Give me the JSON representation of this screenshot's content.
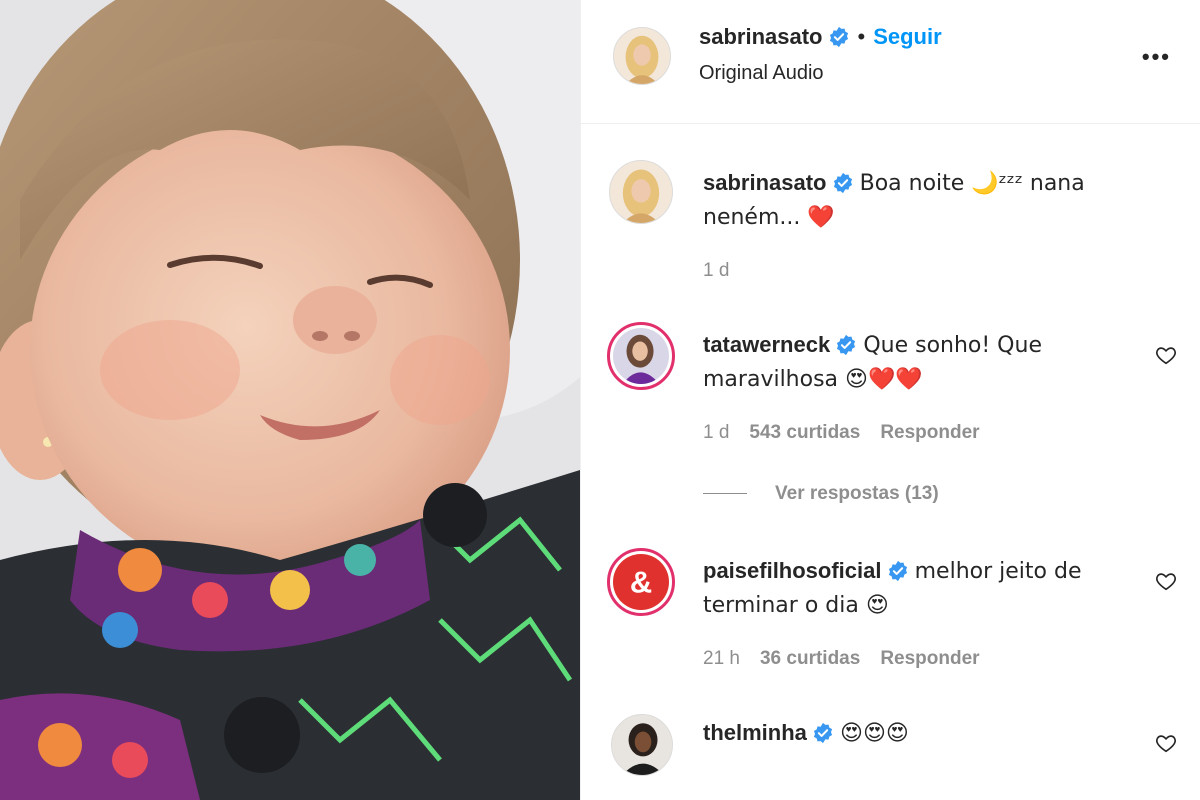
{
  "post": {
    "image_alt_subject": "toddler-photo"
  },
  "header": {
    "username": "sabrinasato",
    "follow_label": "Seguir",
    "separator": "•",
    "audio": "Original Audio",
    "more": "•••"
  },
  "caption": {
    "username": "sabrinasato",
    "text": "Boa noite 🌙ᶻᶻᶻ nana neném... ❤️",
    "time": "1 d"
  },
  "comments": [
    {
      "username": "tatawerneck",
      "text": "Que sonho! Que maravilhosa 😍❤️❤️",
      "time": "1 d",
      "likes": "543 curtidas",
      "reply": "Responder"
    },
    {
      "username": "paisefilhosoficial",
      "text": "melhor jeito de terminar o dia 😍",
      "time": "21 h",
      "likes": "36 curtidas",
      "reply": "Responder"
    },
    {
      "username": "thelminha",
      "text": "😍😍😍"
    }
  ],
  "view_replies": "Ver respostas (13)",
  "colors": {
    "link": "#0095f6",
    "verified": "#3897f0",
    "muted": "#8e8e8e",
    "brand_pf": "#e0312f"
  }
}
